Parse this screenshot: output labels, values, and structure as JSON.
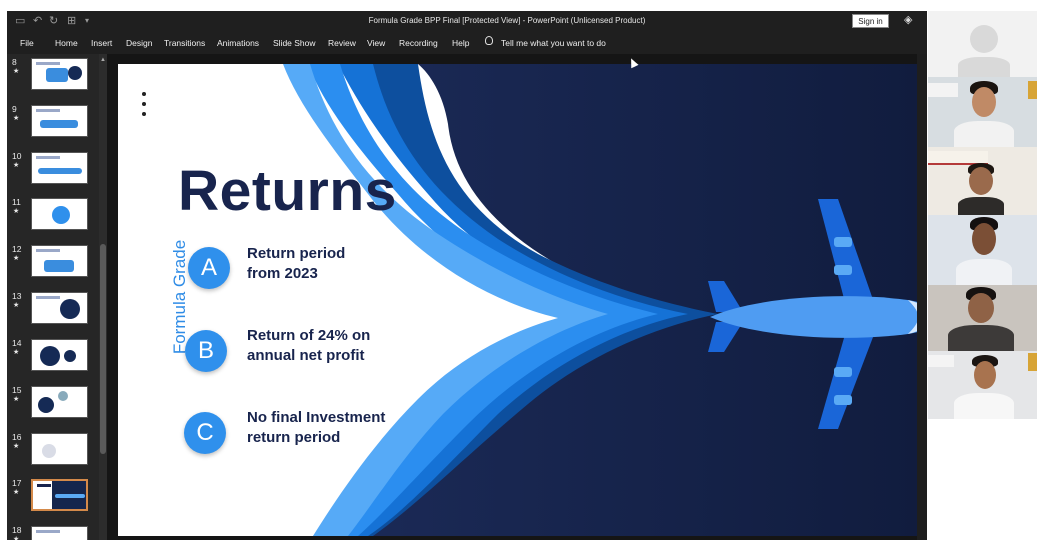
{
  "window": {
    "title": "Formula Grade BPP Final [Protected View]  -  PowerPoint (Unlicensed Product)",
    "signin_label": "Sign in"
  },
  "ribbon": {
    "tabs": [
      "File",
      "Home",
      "Insert",
      "Design",
      "Transitions",
      "Animations",
      "Slide Show",
      "Review",
      "View",
      "Recording",
      "Help"
    ],
    "tell_me": "Tell me what you want to do"
  },
  "thumbnails": [
    {
      "num": "8",
      "star": "★"
    },
    {
      "num": "9",
      "star": "★"
    },
    {
      "num": "10",
      "star": "★"
    },
    {
      "num": "11",
      "star": "★"
    },
    {
      "num": "12",
      "star": "★"
    },
    {
      "num": "13",
      "star": "★"
    },
    {
      "num": "14",
      "star": "★"
    },
    {
      "num": "15",
      "star": "★"
    },
    {
      "num": "16",
      "star": "★"
    },
    {
      "num": "17",
      "star": "★",
      "selected": true
    },
    {
      "num": "18",
      "star": "★"
    }
  ],
  "slide": {
    "title": "Returns",
    "brand": "Formula Grade",
    "items": [
      {
        "letter": "A",
        "line1": "Return period",
        "line2": "from 2023"
      },
      {
        "letter": "B",
        "line1": "Return of 24% on",
        "line2": "annual net profit"
      },
      {
        "letter": "C",
        "line1": "No final Investment",
        "line2": "return period"
      }
    ]
  },
  "colors": {
    "accent_blue": "#2f90ec",
    "navy": "#18244d",
    "slide_bg_dark": "#17254d",
    "selected_thumb": "#d48a4a"
  },
  "icons": {
    "save": "save-icon",
    "undo": "undo-icon",
    "redo": "redo-icon",
    "present": "present-icon",
    "diamond": "diamond-icon",
    "lightbulb": "lightbulb-icon"
  }
}
